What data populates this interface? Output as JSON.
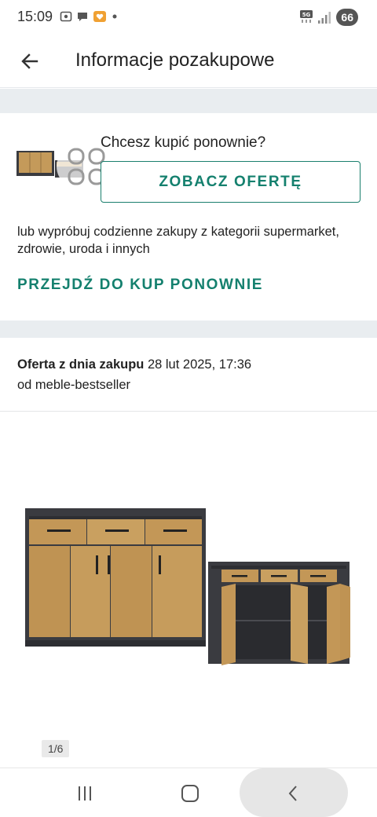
{
  "status_bar": {
    "time": "15:09",
    "left_icons": [
      "screenshot-icon",
      "chat-bubble-icon",
      "heart-app-icon",
      "dot-icon"
    ],
    "network": "5G",
    "battery": "66"
  },
  "app_bar": {
    "title": "Informacje pozakupowe",
    "back_icon": "arrow-left-icon"
  },
  "rebuy": {
    "question": "Chcesz kupić ponownie?",
    "offer_button": "ZOBACZ OFERTĘ",
    "text": "lub wypróbuj codzienne zakupy z kategorii supermarket, zdrowie, uroda i innych",
    "link": "PRZEJDŹ DO KUP PONOWNIE"
  },
  "offer": {
    "date_label": "Oferta z dnia zakupu",
    "date_value": "28 lut 2025, 17:36",
    "seller": "od meble-bestseller"
  },
  "gallery": {
    "counter": "1/6"
  },
  "nav": {
    "recents_icon": "recents-icon",
    "home_icon": "home-icon",
    "back_icon": "back-chevron-icon"
  },
  "colors": {
    "accent": "#14806e",
    "band": "#e9edf0"
  }
}
